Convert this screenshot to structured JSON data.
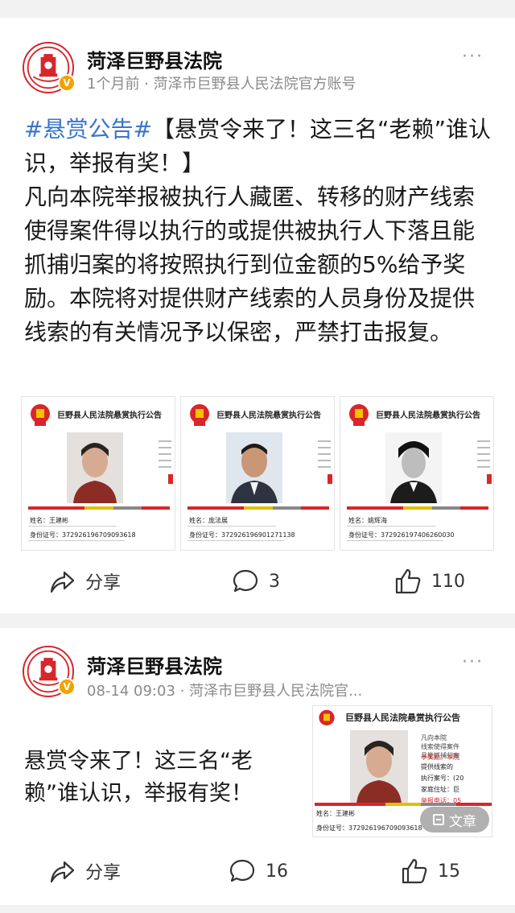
{
  "posts": [
    {
      "author": "菏泽巨野县法院",
      "time": "1个月前",
      "source": "菏泽市巨野县人民法院官方账号",
      "meta_sep": " · ",
      "hashtag": "#悬赏公告#",
      "headline": "【悬赏令来了！这三名“老赖”谁认识，举报有奖！】",
      "body": "凡向本院举报被执行人藏匿、转移的财产线索使得案件得以执行的或提供被执行人下落且能抓捕归案的将按照执行到位金额的5%给予奖励。本院将对提供财产线索的人员身份及提供线索的有关情况予以保密，严禁打击报复。",
      "images": [
        {
          "title": "巨野县人民法院悬赏执行公告",
          "name": "姓名：王建彬",
          "id": "身份证号：372926196709093618"
        },
        {
          "title": "巨野县人民法院悬赏执行公告",
          "name": "姓名：庞法展",
          "id": "身份证号：372926196901271138"
        },
        {
          "title": "巨野县人民法院悬赏执行公告",
          "name": "姓名：姚辉海",
          "id": "身份证号：372926197406260030"
        }
      ],
      "share_label": "分享",
      "comments": "3",
      "likes": "110"
    },
    {
      "author": "菏泽巨野县法院",
      "time": "08-14 09:03",
      "source": "菏泽市巨野县人民法院官...",
      "meta_sep": " · ",
      "text": "悬赏令来了！这三名“老赖”谁认识，举报有奖！",
      "image": {
        "title": "巨野县人民法院悬赏执行公告",
        "body_lines": [
          "凡向本院",
          "线索使得案件",
          "且能抓捕归案"
        ],
        "highlight": "予奖励。本院",
        "body_tail": "提供线索的",
        "case_no": "执行案号：(20",
        "address": "家庭住址：巨",
        "phone": "举报电话：05",
        "name": "姓名：王建彬",
        "id": "身份证号：372926196709093618"
      },
      "article_chip": "文章",
      "share_label": "分享",
      "comments": "16",
      "likes": "15"
    }
  ],
  "colors": {
    "hashtag": "#3a76c9",
    "verified": "#f2a100",
    "court_red": "#d8262b"
  }
}
